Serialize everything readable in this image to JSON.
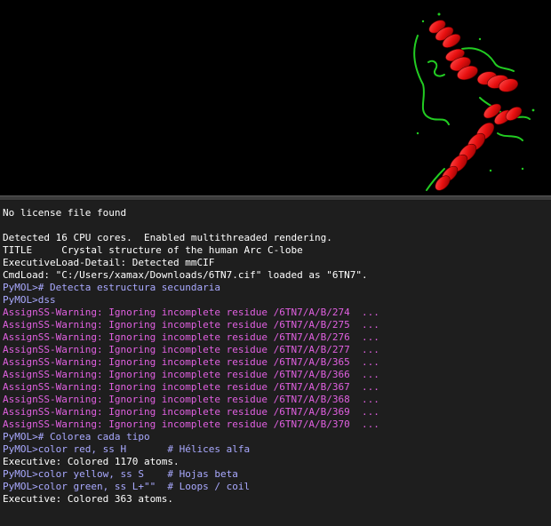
{
  "colors": {
    "background": "#000000",
    "console_bg": "#1e1e1e",
    "output_text": "#ffffff",
    "command_text": "#a9a9ff",
    "warning_text": "#e060e0",
    "helix": "#e81010",
    "loop": "#22cc22"
  },
  "viewport": {
    "structure": "6TN7"
  },
  "console": {
    "lines": [
      {
        "type": "normal",
        "text": "No license file found"
      },
      {
        "type": "normal",
        "text": ""
      },
      {
        "type": "normal",
        "text": "Detected 16 CPU cores.  Enabled multithreaded rendering."
      },
      {
        "type": "normal",
        "text": "TITLE     Crystal structure of the human Arc C-lobe"
      },
      {
        "type": "normal",
        "text": "ExecutiveLoad-Detail: Detected mmCIF"
      },
      {
        "type": "normal",
        "text": "CmdLoad: \"C:/Users/xamax/Downloads/6TN7.cif\" loaded as \"6TN7\"."
      },
      {
        "type": "cmd",
        "text": "PyMOL># Detecta estructura secundaria"
      },
      {
        "type": "cmd",
        "text": "PyMOL>dss"
      },
      {
        "type": "warn",
        "text": "AssignSS-Warning: Ignoring incomplete residue /6TN7/A/B/274  ..."
      },
      {
        "type": "warn",
        "text": "AssignSS-Warning: Ignoring incomplete residue /6TN7/A/B/275  ..."
      },
      {
        "type": "warn",
        "text": "AssignSS-Warning: Ignoring incomplete residue /6TN7/A/B/276  ..."
      },
      {
        "type": "warn",
        "text": "AssignSS-Warning: Ignoring incomplete residue /6TN7/A/B/277  ..."
      },
      {
        "type": "warn",
        "text": "AssignSS-Warning: Ignoring incomplete residue /6TN7/A/B/365  ..."
      },
      {
        "type": "warn",
        "text": "AssignSS-Warning: Ignoring incomplete residue /6TN7/A/B/366  ..."
      },
      {
        "type": "warn",
        "text": "AssignSS-Warning: Ignoring incomplete residue /6TN7/A/B/367  ..."
      },
      {
        "type": "warn",
        "text": "AssignSS-Warning: Ignoring incomplete residue /6TN7/A/B/368  ..."
      },
      {
        "type": "warn",
        "text": "AssignSS-Warning: Ignoring incomplete residue /6TN7/A/B/369  ..."
      },
      {
        "type": "warn",
        "text": "AssignSS-Warning: Ignoring incomplete residue /6TN7/A/B/370  ..."
      },
      {
        "type": "cmd",
        "text": "PyMOL># Colorea cada tipo"
      },
      {
        "type": "cmd",
        "text": "PyMOL>color red, ss H       # Hélices alfa"
      },
      {
        "type": "normal",
        "text": "Executive: Colored 1170 atoms."
      },
      {
        "type": "cmd",
        "text": "PyMOL>color yellow, ss S    # Hojas beta"
      },
      {
        "type": "cmd",
        "text": "PyMOL>color green, ss L+\"\"  # Loops / coil"
      },
      {
        "type": "normal",
        "text": "Executive: Colored 363 atoms."
      }
    ]
  }
}
